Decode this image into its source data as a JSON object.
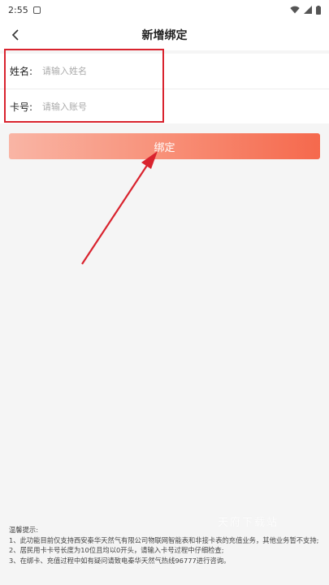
{
  "status_bar": {
    "time": "2:55"
  },
  "nav": {
    "title": "新增绑定",
    "back_icon": "chevron-left-icon"
  },
  "form": {
    "name_label": "姓名:",
    "name_placeholder": "请输入姓名",
    "card_label": "卡号:",
    "card_placeholder": "请输入账号"
  },
  "bind_button": {
    "label": "绑定"
  },
  "notes": {
    "title": "温馨提示:",
    "items": [
      "1、此功能目前仅支持西安秦华天然气有限公司物联网智能表和非接卡表的充值业务，其他业务暂不支持;",
      "2、居民用卡卡号长度为10位且均以0开头，请输入卡号过程中仔细检查;",
      "3、在绑卡、充值过程中如有疑问请致电秦华天然气热线96777进行咨询。"
    ]
  },
  "watermark": "天府下载站",
  "colors": {
    "accent_start": "#f9b5a5",
    "accent_end": "#f5694d",
    "annotation_red": "#d9232e"
  }
}
